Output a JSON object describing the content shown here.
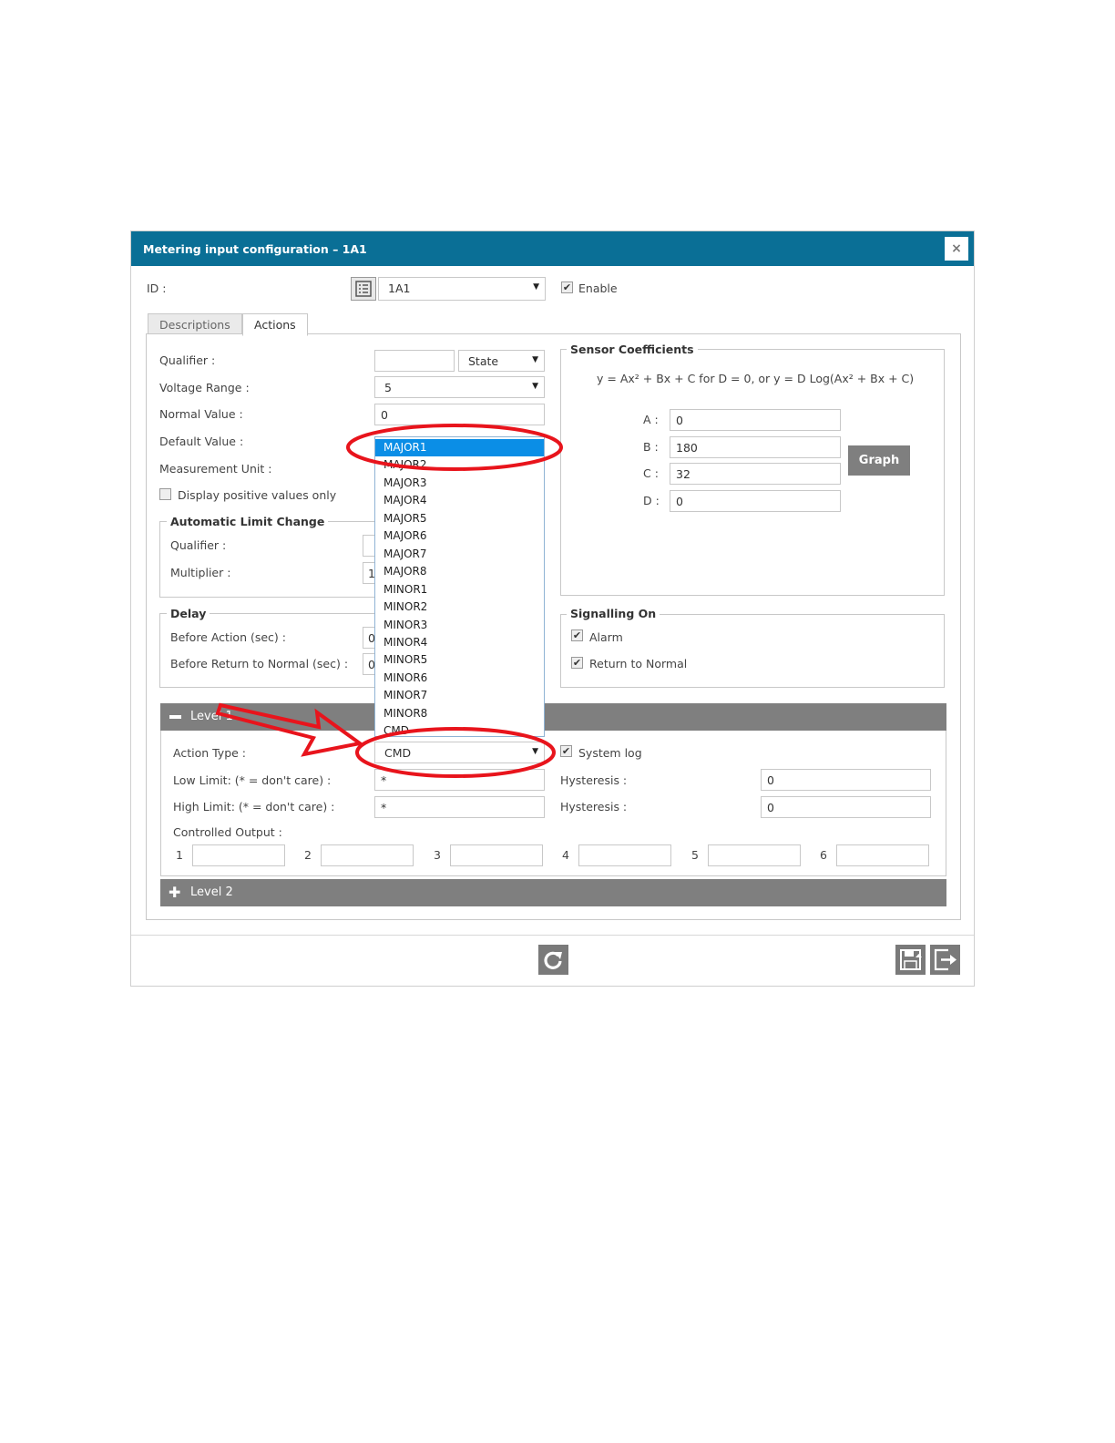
{
  "dialog": {
    "title": "Metering input configuration – 1A1",
    "close_label": "×"
  },
  "header": {
    "id_label": "ID :",
    "id_value": "1A1",
    "enable_label": "Enable",
    "enable_checked": true
  },
  "tabs": [
    {
      "label": "Descriptions",
      "active": false
    },
    {
      "label": "Actions",
      "active": true
    }
  ],
  "left": {
    "qualifier_label": "Qualifier :",
    "qualifier_value": "",
    "qualifier_type": "State",
    "voltage_range_label": "Voltage Range :",
    "voltage_range_value": "5",
    "normal_value_label": "Normal Value :",
    "normal_value": "0",
    "default_value_label": "Default Value :",
    "measurement_unit_label": "Measurement Unit :",
    "positive_only_label": "Display positive values only"
  },
  "auto_limit": {
    "legend": "Automatic Limit Change",
    "qualifier_label": "Qualifier :",
    "multiplier_label": "Multiplier :",
    "multiplier_value": "1"
  },
  "delay": {
    "legend": "Delay",
    "before_action_label": "Before Action (sec) :",
    "before_action_value": "0",
    "before_return_label": "Before Return to Normal (sec) :",
    "before_return_value": "0"
  },
  "sensor": {
    "legend": "Sensor Coefficients",
    "formula": "y = Ax² + Bx + C for D = 0, or y = D Log(Ax² + Bx + C)",
    "coefficients": [
      {
        "label": "A :",
        "value": "0"
      },
      {
        "label": "B :",
        "value": "180"
      },
      {
        "label": "C :",
        "value": "32"
      },
      {
        "label": "D :",
        "value": "0"
      }
    ],
    "graph_label": "Graph"
  },
  "signalling": {
    "legend": "Signalling On",
    "alarm_label": "Alarm",
    "return_label": "Return to Normal"
  },
  "dropdown": {
    "items": [
      "MAJOR1",
      "MAJOR2",
      "MAJOR3",
      "MAJOR4",
      "MAJOR5",
      "MAJOR6",
      "MAJOR7",
      "MAJOR8",
      "MINOR1",
      "MINOR2",
      "MINOR3",
      "MINOR4",
      "MINOR5",
      "MINOR6",
      "MINOR7",
      "MINOR8",
      "CMD"
    ],
    "highlighted": "MAJOR1"
  },
  "level1": {
    "title": "Level 1",
    "action_type_label": "Action Type :",
    "action_type_value": "CMD",
    "system_log_label": "System log",
    "low_limit_label": "Low Limit: (* = don't care) :",
    "low_limit_value": "*",
    "high_limit_label": "High Limit: (* = don't care) :",
    "high_limit_value": "*",
    "hysteresis_label": "Hysteresis :",
    "hysteresis_low_value": "0",
    "hysteresis_high_value": "0",
    "controlled_output_label": "Controlled Output :",
    "outputs": [
      "1",
      "2",
      "3",
      "4",
      "5",
      "6"
    ]
  },
  "level2": {
    "title": "Level 2"
  },
  "colors": {
    "titlebar": "#0a6f96",
    "highlight": "#0b8ee6",
    "annotation": "#e8141c",
    "bar": "#7f7f7f"
  }
}
